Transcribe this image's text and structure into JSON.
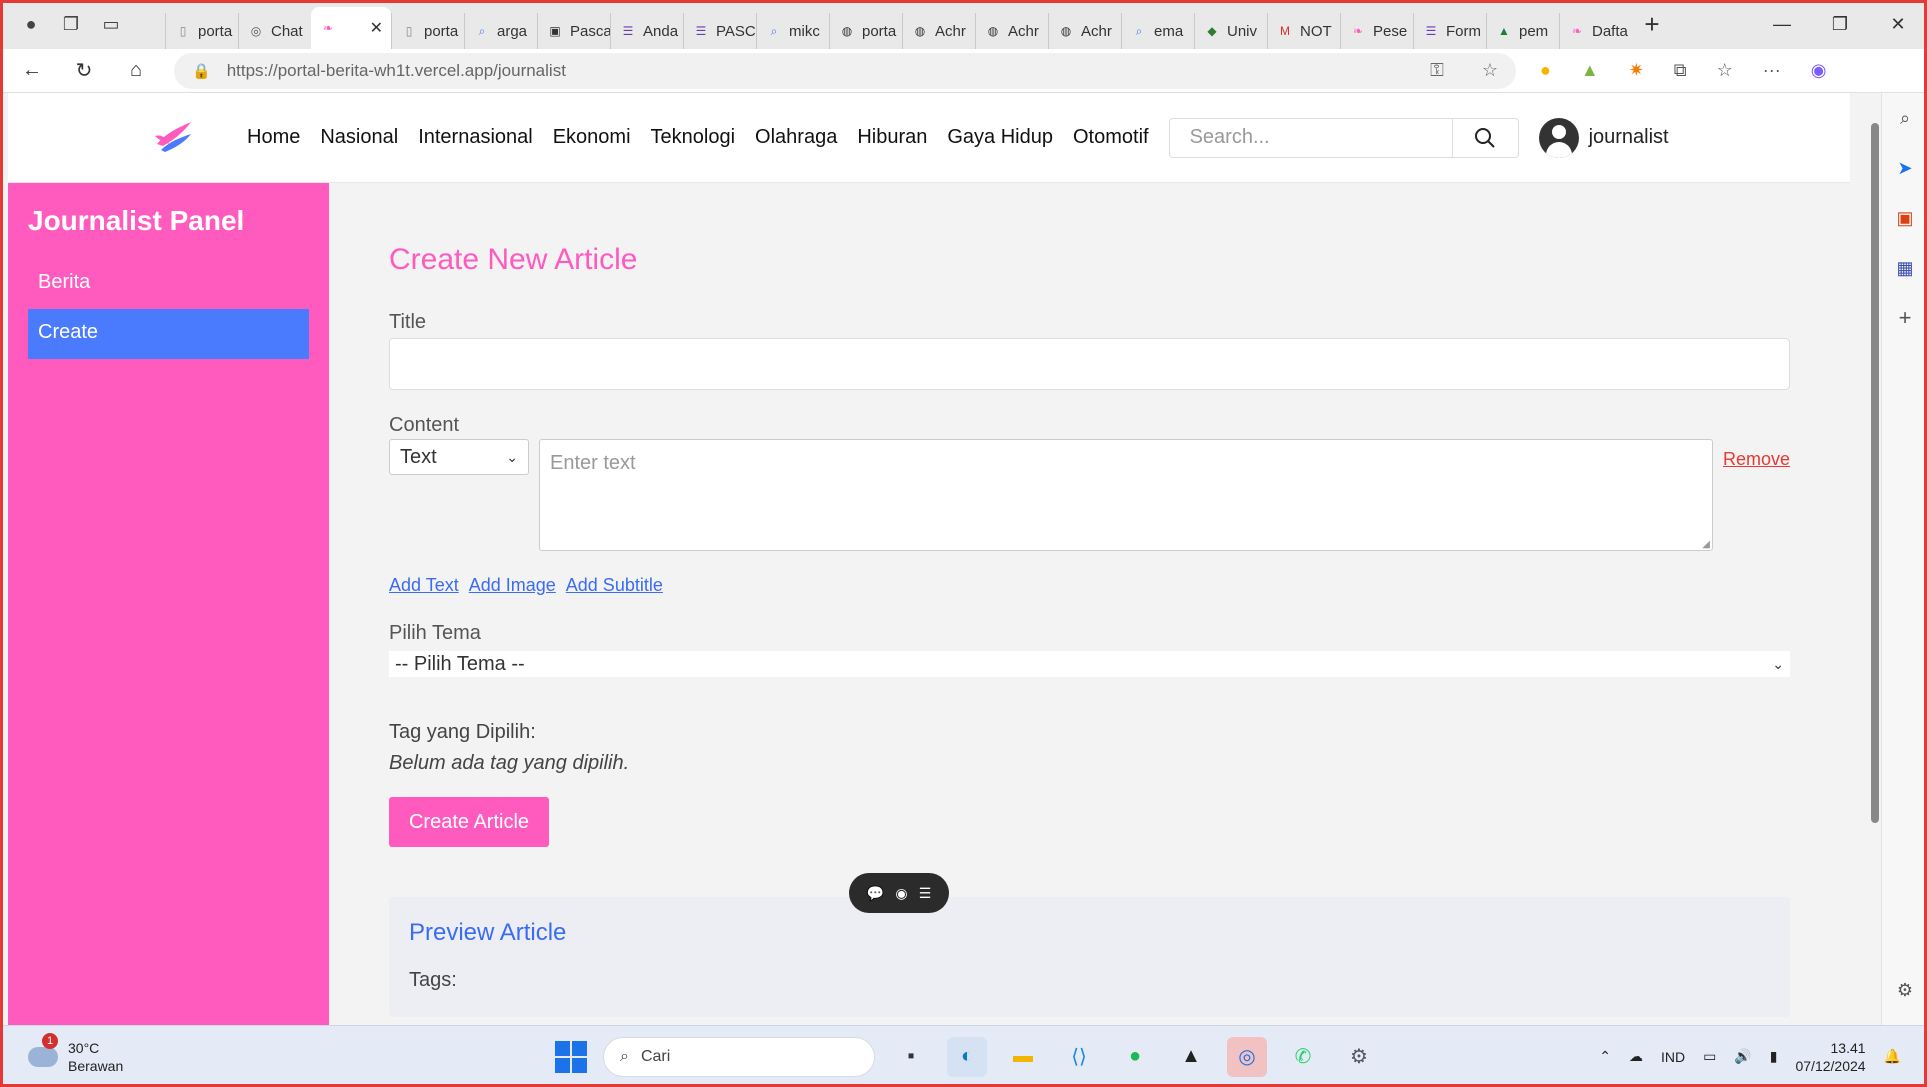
{
  "browser": {
    "tabs": [
      {
        "label": "porta",
        "icon": "page-icon"
      },
      {
        "label": "Chat",
        "icon": "chatgpt-icon"
      },
      {
        "label": "",
        "icon": "portal-logo-icon",
        "active": true
      },
      {
        "label": "porta",
        "icon": "page-icon"
      },
      {
        "label": "arga",
        "icon": "search-icon"
      },
      {
        "label": "Pasca",
        "icon": "contact-icon"
      },
      {
        "label": "Anda",
        "icon": "form-icon"
      },
      {
        "label": "PASC",
        "icon": "form-icon"
      },
      {
        "label": "mikc",
        "icon": "search-icon"
      },
      {
        "label": "porta",
        "icon": "github-icon"
      },
      {
        "label": "Achr",
        "icon": "github-icon"
      },
      {
        "label": "Achr",
        "icon": "github-icon"
      },
      {
        "label": "Achr",
        "icon": "github-icon"
      },
      {
        "label": "ema",
        "icon": "search-icon"
      },
      {
        "label": "Univ",
        "icon": "university-icon"
      },
      {
        "label": "NOT",
        "icon": "gmail-icon"
      },
      {
        "label": "Pese",
        "icon": "portal-logo-icon"
      },
      {
        "label": "Form",
        "icon": "form-icon"
      },
      {
        "label": "pem",
        "icon": "drive-icon"
      },
      {
        "label": "Dafta",
        "icon": "portal-logo-icon"
      }
    ],
    "url_host": "https://portal-berita-wh1t.vercel.app",
    "url_path": "/journalist"
  },
  "site": {
    "menu": [
      "Home",
      "Nasional",
      "Internasional",
      "Ekonomi",
      "Teknologi",
      "Olahraga",
      "Hiburan",
      "Gaya Hidup",
      "Otomotif"
    ],
    "search_placeholder": "Search...",
    "username": "journalist"
  },
  "panel": {
    "title": "Journalist Panel",
    "items": [
      "Berita",
      "Create"
    ],
    "active": "Create"
  },
  "form": {
    "heading": "Create New Article",
    "title_label": "Title",
    "content_label": "Content",
    "type_value": "Text",
    "content_placeholder": "Enter text",
    "remove_label": "Remove",
    "add_text": "Add Text",
    "add_image": "Add Image",
    "add_subtitle": "Add Subtitle",
    "tema_label": "Pilih Tema",
    "tema_value": "-- Pilih Tema --",
    "tags_heading": "Tag yang Dipilih:",
    "tags_empty": "Belum ada tag yang dipilih.",
    "submit_label": "Create Article"
  },
  "preview": {
    "heading": "Preview Article",
    "tags_label": "Tags:"
  },
  "taskbar": {
    "weather_temp": "30°C",
    "weather_desc": "Berawan",
    "weather_badge": "1",
    "search_label": "Cari",
    "language": "IND",
    "time": "13.41",
    "date": "07/12/2024"
  },
  "colors": {
    "accent_pink": "#ff5bbf",
    "accent_blue": "#4a7bff",
    "remove_red": "#e53935"
  }
}
